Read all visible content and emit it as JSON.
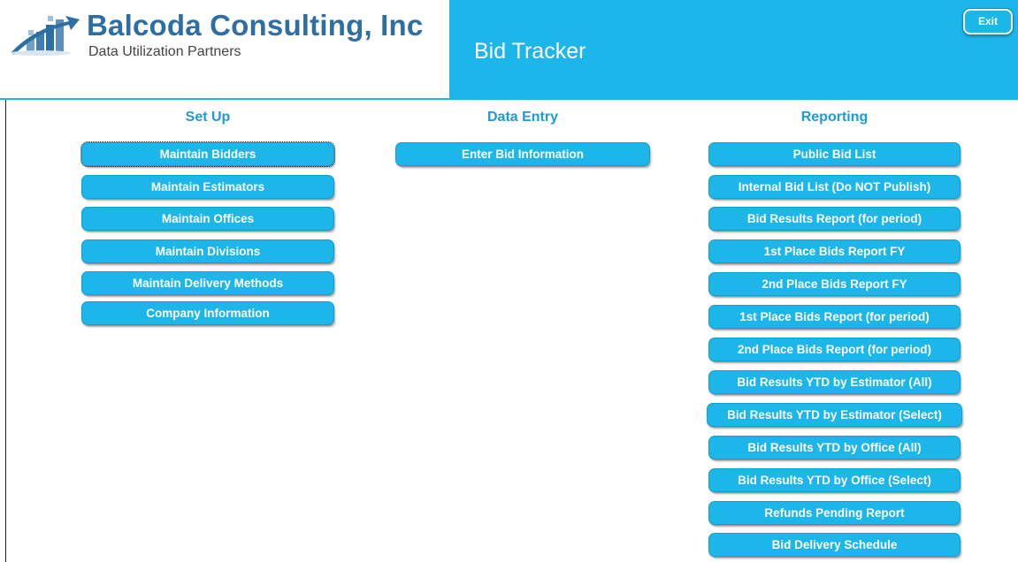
{
  "header": {
    "company_name": "Balcoda Consulting, Inc",
    "tagline": "Data Utilization Partners",
    "app_title": "Bid Tracker",
    "exit_label": "Exit",
    "accent_color": "#1cb6ea",
    "logo_icon": "balcoda-logo-icon"
  },
  "sections": {
    "setup": {
      "heading": "Set Up",
      "buttons": [
        "Maintain Bidders",
        "Maintain Estimators",
        "Maintain Offices",
        "Maintain Divisions",
        "Maintain Delivery Methods",
        "Company Information"
      ]
    },
    "data_entry": {
      "heading": "Data Entry",
      "buttons": [
        "Enter Bid Information"
      ]
    },
    "reporting": {
      "heading": "Reporting",
      "buttons": [
        "Public Bid List",
        "Internal Bid List (Do NOT Publish)",
        "Bid Results Report (for period)",
        "1st Place Bids Report FY",
        "2nd Place Bids Report FY",
        "1st Place Bids Report (for period)",
        "2nd Place Bids Report (for period)",
        "Bid Results YTD by Estimator (All)",
        "Bid Results YTD by Estimator (Select)",
        "Bid Results YTD by Office (All)",
        "Bid Results YTD by Office (Select)",
        "Refunds Pending Report",
        "Bid Delivery Schedule"
      ]
    }
  }
}
